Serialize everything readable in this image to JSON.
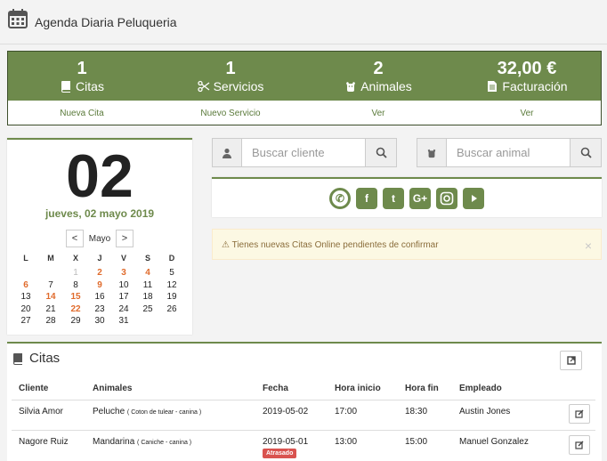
{
  "app": {
    "title": "Agenda Diaria Peluqueria"
  },
  "colors": {
    "accent": "#6e8a4c",
    "highlight": "#e06b2c",
    "danger": "#d9534f"
  },
  "stats": [
    {
      "value": "1",
      "label": "Citas",
      "icon": "book-icon",
      "link": "Nueva Cita"
    },
    {
      "value": "1",
      "label": "Servicios",
      "icon": "scissors-icon",
      "link": "Nuevo Servicio"
    },
    {
      "value": "2",
      "label": "Animales",
      "icon": "dog-icon",
      "link": "Ver"
    },
    {
      "value": "32,00 €",
      "label": "Facturación",
      "icon": "document-icon",
      "link": "Ver"
    }
  ],
  "calendar": {
    "day": "02",
    "date_label": "jueves, 02 mayo 2019",
    "month": "Mayo",
    "prev": "<",
    "next": ">",
    "weekdays": [
      "L",
      "M",
      "X",
      "J",
      "V",
      "S",
      "D"
    ],
    "rows": [
      [
        null,
        null,
        "1",
        "2",
        "3",
        "4",
        "5"
      ],
      [
        "6",
        "7",
        "8",
        "9",
        "10",
        "11",
        "12"
      ],
      [
        "13",
        "14",
        "15",
        "16",
        "17",
        "18",
        "19"
      ],
      [
        "20",
        "21",
        "22",
        "23",
        "24",
        "25",
        "26"
      ],
      [
        "27",
        "28",
        "29",
        "30",
        "31",
        null,
        null
      ]
    ],
    "highlighted": [
      "2",
      "3",
      "4",
      "6",
      "9",
      "14",
      "15",
      "22"
    ],
    "muted": [
      "1"
    ]
  },
  "search": {
    "client_placeholder": "Buscar cliente",
    "animal_placeholder": "Buscar animal"
  },
  "social": [
    "whatsapp-icon",
    "facebook-icon",
    "twitter-icon",
    "google-plus-icon",
    "instagram-icon",
    "youtube-icon"
  ],
  "alert": {
    "message": "Tienes nuevas Citas Online pendientes de confirmar",
    "close": "×"
  },
  "citas": {
    "title": "Citas",
    "columns": [
      "Cliente",
      "Animales",
      "Fecha",
      "Hora inicio",
      "Hora fin",
      "Empleado"
    ],
    "rows": [
      {
        "cliente": "Silvia Amor",
        "animal": "Peluche",
        "animal_detail": "( Coton de tulear - canina )",
        "fecha": "2019-05-02",
        "badge": "",
        "hora_inicio": "17:00",
        "hora_fin": "18:30",
        "empleado": "Austin Jones"
      },
      {
        "cliente": "Nagore Ruiz",
        "animal": "Mandarina",
        "animal_detail": "( Caniche - canina )",
        "fecha": "2019-05-01",
        "badge": "Atrasado",
        "hora_inicio": "13:00",
        "hora_fin": "15:00",
        "empleado": "Manuel Gonzalez"
      }
    ]
  }
}
